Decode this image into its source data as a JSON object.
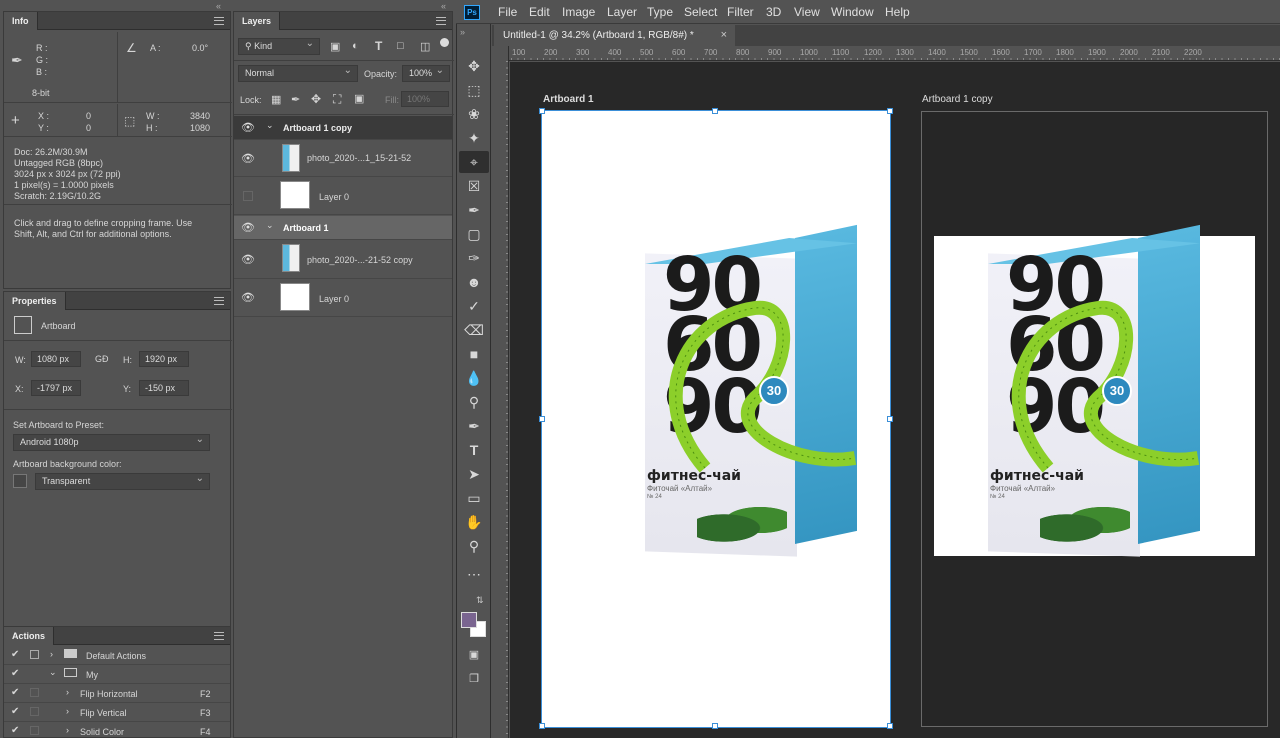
{
  "menubar": {
    "logo": "Ps",
    "items": [
      "File",
      "Edit",
      "Image",
      "Layer",
      "Type",
      "Select",
      "Filter",
      "3D",
      "View",
      "Window",
      "Help"
    ]
  },
  "document_tab": {
    "title": "Untitled-1 @ 34.2% (Artboard 1, RGB/8#) *",
    "close": "×"
  },
  "ruler": {
    "ticks": [
      "100",
      "200",
      "300",
      "400",
      "500",
      "600",
      "700",
      "800",
      "900",
      "1000",
      "1100",
      "1200",
      "1300",
      "1400",
      "1500",
      "1600",
      "1700",
      "1800",
      "1900",
      "2000",
      "2100",
      "2200"
    ]
  },
  "info": {
    "title": "Info",
    "rgb_labels": [
      "R :",
      "G :",
      "B :"
    ],
    "angle_label": "A :",
    "angle_value": "0.0°",
    "bit_depth": "8-bit",
    "x_label": "X :",
    "x_value": "0",
    "y_label": "Y :",
    "y_value": "0",
    "w_label": "W :",
    "w_value": "3840",
    "h_label": "H :",
    "h_value": "1080",
    "doc_lines": [
      "Doc: 26.2M/30.9M",
      "Untagged RGB (8bpc)",
      "3024 px x 3024 px (72 ppi)",
      "1 pixel(s) = 1.0000 pixels",
      "Scratch: 2.19G/10.2G"
    ],
    "hint": "Click and drag to define cropping frame. Use Shift, Alt, and Ctrl for additional options."
  },
  "properties": {
    "title": "Properties",
    "type": "Artboard",
    "w_label": "W:",
    "w_value": "1080 px",
    "h_label": "H:",
    "h_value": "1920 px",
    "x_label": "X:",
    "x_value": "-1797 px",
    "y_label": "Y:",
    "y_value": "-150 px",
    "preset_label": "Set Artboard to Preset:",
    "preset_value": "Android 1080p",
    "bg_label": "Artboard background color:",
    "bg_value": "Transparent"
  },
  "actions": {
    "title": "Actions",
    "items": [
      {
        "label": "Default Actions",
        "shortcut": ""
      },
      {
        "label": "My",
        "shortcut": ""
      },
      {
        "label": "Flip Horizontal",
        "shortcut": "F2"
      },
      {
        "label": "Flip Vertical",
        "shortcut": "F3"
      },
      {
        "label": "Solid Color",
        "shortcut": "F4"
      }
    ]
  },
  "layers": {
    "title": "Layers",
    "filter": "Kind",
    "blend": "Normal",
    "opacity_label": "Opacity:",
    "opacity_value": "100%",
    "lock_label": "Lock:",
    "fill_label": "Fill:",
    "fill_value": "100%",
    "rows": [
      {
        "label": "Artboard 1 copy"
      },
      {
        "label": "photo_2020-...1_15-21-52"
      },
      {
        "label": "Layer 0"
      },
      {
        "label": "Artboard 1"
      },
      {
        "label": "photo_2020-...-21-52 copy"
      },
      {
        "label": "Layer 0"
      }
    ]
  },
  "canvas": {
    "artboard1_label": "Artboard 1",
    "artboard2_label": "Artboard 1 copy",
    "product": {
      "n1": "90",
      "n2": "60",
      "n3": "90",
      "brand": "фитнес-чай",
      "sub": "Фиточай «Алтай»",
      "badge": "30",
      "code": "№ 24"
    }
  },
  "colors": {
    "foreground": "#7a6590",
    "background": "#ffffff",
    "accent": "#31a8ff"
  }
}
